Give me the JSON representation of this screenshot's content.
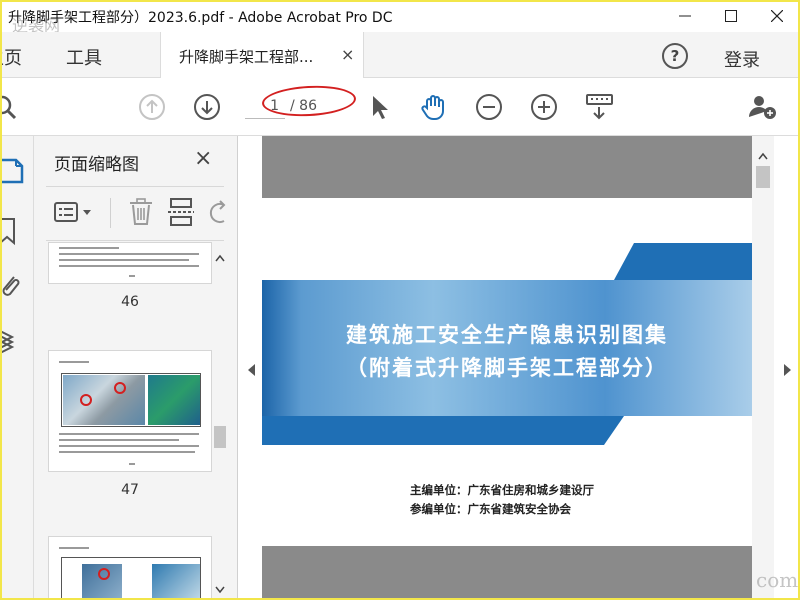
{
  "window": {
    "title": "升降脚手架工程部分）2023.6.pdf - Adobe Acrobat Pro DC",
    "watermark_logo": "逆袭网"
  },
  "nav": {
    "home": "主页",
    "tools": "工具",
    "doc_tab": "升降脚手架工程部...",
    "doc_tab_close": "×",
    "help": "?",
    "login": "登录"
  },
  "toolbar": {
    "current_page": "1",
    "total_pages": "/ 86"
  },
  "thumbnails": {
    "panel_title": "页面缩略图",
    "close": "×",
    "pages": [
      {
        "number": "46"
      },
      {
        "number": "47"
      }
    ]
  },
  "document": {
    "cover_title_line1": "建筑施工安全生产隐患识别图集",
    "cover_title_line2": "（附着式升降脚手架工程部分）",
    "editor_line1": "主编单位：广东省住房和城乡建设厅",
    "editor_line2": "参编单位：广东省建筑安全协会"
  },
  "watermark_com": "com",
  "colors": {
    "accent_blue": "#1f6fb5",
    "annotation_red": "#d32020",
    "frame_yellow": "#f2e64a"
  }
}
